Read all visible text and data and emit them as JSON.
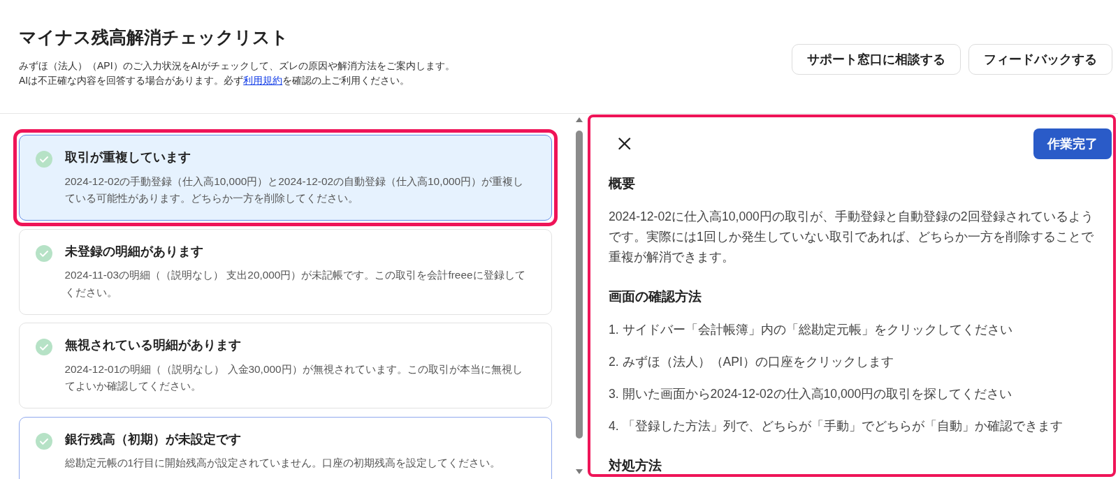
{
  "header": {
    "title": "マイナス残高解消チェックリスト",
    "description": "みずほ（法人）（API）のご入力状況をAIがチェックして、ズレの原因や解消方法をご案内します。",
    "disclaimer": {
      "text_before": "AIは不正確な内容を回答する場合があります。必ず",
      "link": "利用規約",
      "text_after": "を確認の上ご利用ください。"
    },
    "buttons": [
      "サポート窓口に相談する",
      "フィードバックする"
    ]
  },
  "checklist": [
    {
      "title": "取引が重複しています",
      "description": "2024-12-02の手動登録（仕入高10,000円）と2024-12-02の自動登録（仕入高10,000円）が重複している可能性があります。どちらか一方を削除してください。",
      "selected": true,
      "hovered": false,
      "highlighted": true
    },
    {
      "title": "未登録の明細があります",
      "description": "2024-11-03の明細（（説明なし） 支出20,000円）が未記帳です。この取引を会計freeeに登録してください。",
      "selected": false,
      "hovered": false,
      "highlighted": false
    },
    {
      "title": "無視されている明細があります",
      "description": "2024-12-01の明細（（説明なし） 入金30,000円）が無視されています。この取引が本当に無視してよいか確認してください。",
      "selected": false,
      "hovered": false,
      "highlighted": false
    },
    {
      "title": "銀行残高（初期）が未設定です",
      "description": "総勘定元帳の1行目に開始残高が設定されていません。口座の初期残高を設定してください。",
      "selected": false,
      "hovered": true,
      "highlighted": false
    }
  ],
  "detail": {
    "highlighted": true,
    "done_button": "作業完了",
    "sections": [
      {
        "kind": "paragraph",
        "heading": "概要",
        "text": "2024-12-02に仕入高10,000円の取引が、手動登録と自動登録の2回登録されているようです。実際には1回しか発生していない取引であれば、どちらか一方を削除することで重複が解消できます。"
      },
      {
        "kind": "steps",
        "heading": "画面の確認方法",
        "steps": [
          "1. サイドバー「会計帳簿」内の「総勘定元帳」をクリックしてください",
          "2. みずほ（法人）（API）の口座をクリックします",
          "3. 開いた画面から2024-12-02の仕入高10,000円の取引を探してください",
          "4. 「登録した方法」列で、どちらが「手動」でどちらが「自動」か確認できます"
        ]
      },
      {
        "kind": "heading",
        "heading": "対処方法"
      }
    ]
  }
}
